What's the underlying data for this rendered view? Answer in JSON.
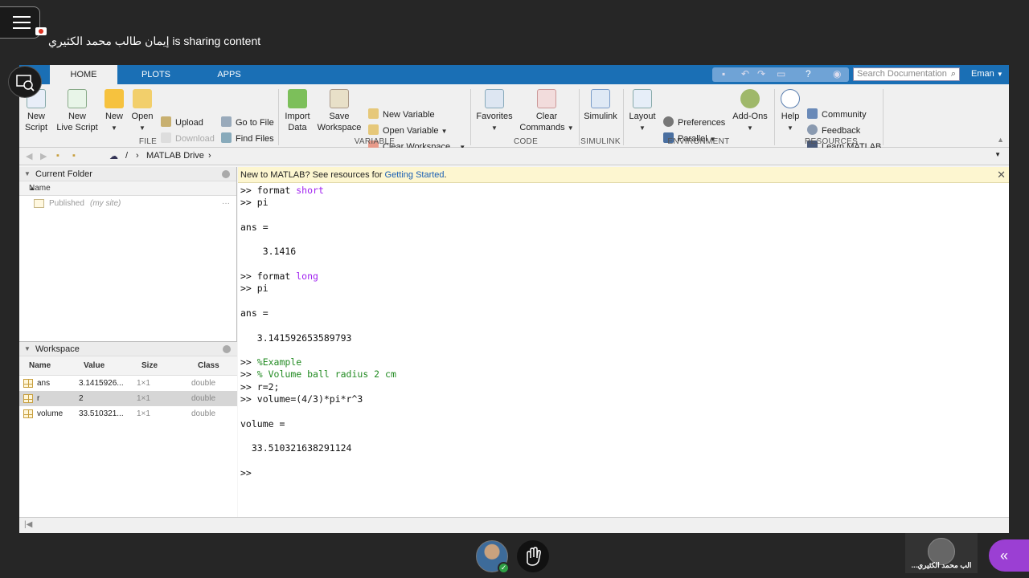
{
  "meeting": {
    "sharing_text": "إيمان طالب محمد الكثيري is sharing content",
    "participant_name": "...الب محمد الكثيري",
    "collapse_glyph": "«",
    "icons": [
      "hamburger-icon",
      "recording-icon",
      "share-view-icon",
      "check-icon",
      "raise-hand-icon",
      "chevron-left-icon"
    ]
  },
  "matlab": {
    "tabs": [
      {
        "label": "HOME",
        "active": true
      },
      {
        "label": "PLOTS",
        "active": false
      },
      {
        "label": "APPS",
        "active": false
      }
    ],
    "search_placeholder": "Search Documentation",
    "user": "Eman",
    "ribbon": {
      "file": {
        "group": "FILE",
        "new_script": [
          "New",
          "Script"
        ],
        "new_live_script": [
          "New",
          "Live Script"
        ],
        "new": "New",
        "open": "Open",
        "upload": "Upload",
        "download": "Download",
        "go_to_file": "Go to File",
        "find_files": "Find Files"
      },
      "variable": {
        "group": "VARIABLE",
        "import_data": [
          "Import",
          "Data"
        ],
        "save_workspace": [
          "Save",
          "Workspace"
        ],
        "new_variable": "New Variable",
        "open_variable": "Open Variable",
        "clear_workspace": "Clear Workspace"
      },
      "code": {
        "group": "CODE",
        "favorites": "Favorites",
        "clear_commands": [
          "Clear",
          "Commands"
        ]
      },
      "simulink": {
        "group": "SIMULINK",
        "simulink": "Simulink"
      },
      "environment": {
        "group": "ENVIRONMENT",
        "layout": "Layout",
        "preferences": "Preferences",
        "parallel": "Parallel",
        "add_ons": "Add-Ons"
      },
      "resources": {
        "group": "RESOURCES",
        "help": "Help",
        "community": "Community",
        "feedback": "Feedback",
        "learn_matlab": "Learn MATLAB"
      }
    },
    "address": {
      "root": "/",
      "sep": "›",
      "folder": "MATLAB Drive"
    },
    "current_folder": {
      "title": "Current Folder",
      "col_name": "Name",
      "sort_glyph": "▲",
      "item_name": "Published",
      "item_note": "(my site)",
      "item_more": "···"
    },
    "workspace": {
      "title": "Workspace",
      "columns": [
        "Name",
        "Value",
        "Size",
        "Class"
      ],
      "rows": [
        {
          "name": "ans",
          "value": "3.1415926...",
          "size": "1×1",
          "class": "double",
          "selected": false
        },
        {
          "name": "r",
          "value": "2",
          "size": "1×1",
          "class": "double",
          "selected": true
        },
        {
          "name": "volume",
          "value": "33.510321...",
          "size": "1×1",
          "class": "double",
          "selected": false
        }
      ]
    },
    "notice": {
      "text": "New to MATLAB? See resources for ",
      "link": "Getting Started",
      "end": ".",
      "close": "✕"
    },
    "command_lines": [
      {
        "p": ">> ",
        "t": "format ",
        "k": "short"
      },
      {
        "p": ">> ",
        "t": "pi"
      },
      {
        "t": ""
      },
      {
        "t": "ans ="
      },
      {
        "t": ""
      },
      {
        "t": "    3.1416"
      },
      {
        "t": ""
      },
      {
        "p": ">> ",
        "t": "format ",
        "k": "long"
      },
      {
        "p": ">> ",
        "t": "pi"
      },
      {
        "t": ""
      },
      {
        "t": "ans ="
      },
      {
        "t": ""
      },
      {
        "t": "   3.141592653589793"
      },
      {
        "t": ""
      },
      {
        "p": ">> ",
        "c": "%Example"
      },
      {
        "p": ">> ",
        "c": "% Volume ball radius 2 cm"
      },
      {
        "p": ">> ",
        "t": "r=2;"
      },
      {
        "p": ">> ",
        "t": "volume=(4/3)*pi*r^3"
      },
      {
        "t": ""
      },
      {
        "t": "volume ="
      },
      {
        "t": ""
      },
      {
        "t": "  33.510321638291124"
      },
      {
        "t": ""
      },
      {
        "p": ">> ",
        "t": ""
      }
    ]
  }
}
